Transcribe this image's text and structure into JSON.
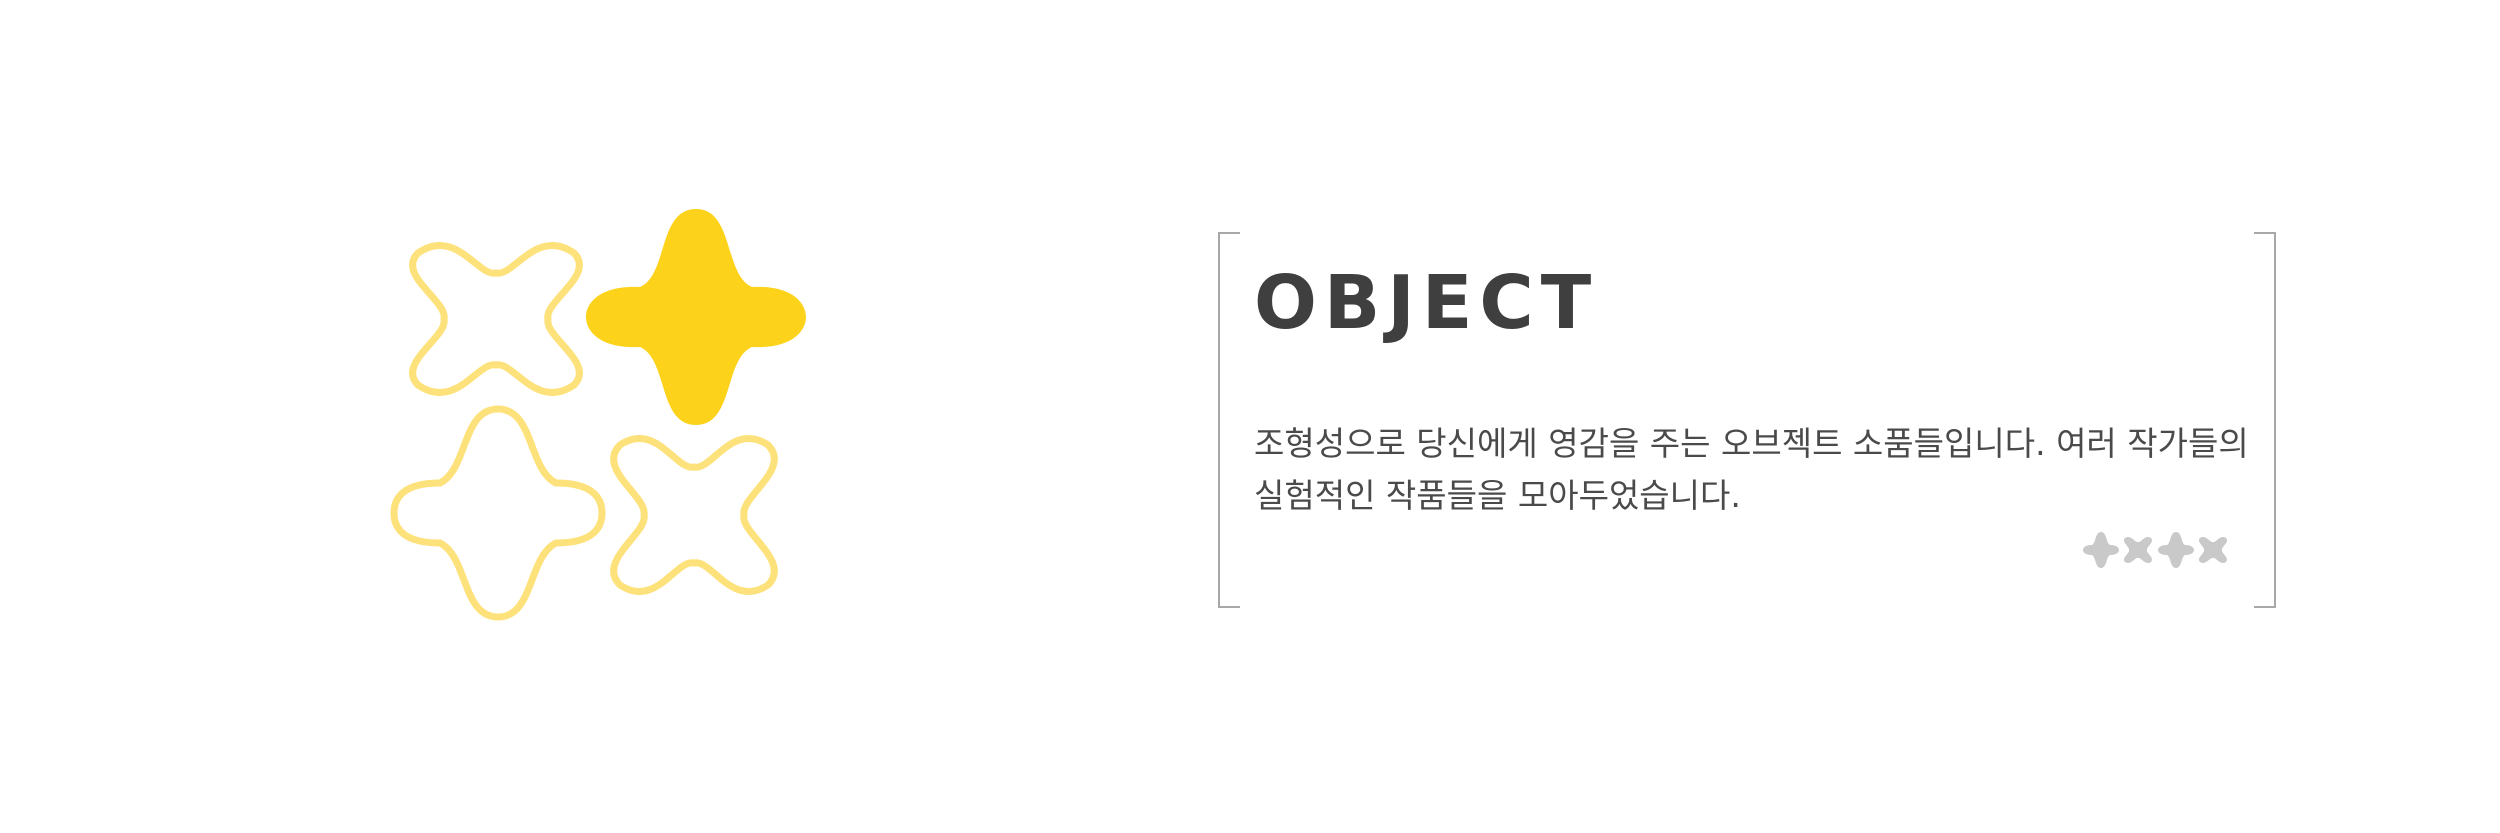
{
  "card": {
    "title": "OBJECT",
    "description": "조형성으로 당신에게 영감을 주는 오브젝트 소품들입니다. 여러 작가들의 실험적인 작품들을 모아두었습니다."
  },
  "colors": {
    "brand_yellow": "#fcd21a",
    "outline_yellow": "#fde17a",
    "title_text": "#3f3f3f",
    "body_text": "#4a4a4a",
    "bracket_gray": "#a8a8a8",
    "mini_icon_gray": "#c9c9c9"
  },
  "icons": {
    "logo": [
      "flower-outline-icon",
      "flower-filled-icon",
      "flower-outline-icon",
      "flower-outline-icon"
    ],
    "category_shapes": [
      "star-shape-icon",
      "clover-shape-icon",
      "star-shape-icon",
      "clover-shape-icon"
    ]
  }
}
